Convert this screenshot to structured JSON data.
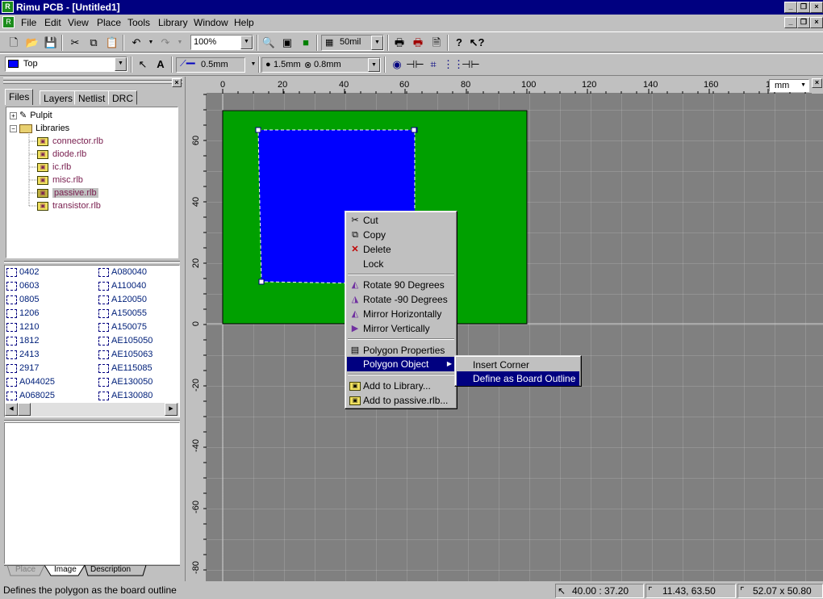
{
  "window": {
    "title": "Rimu PCB - [Untitled1]",
    "app_icon": "rimu-app-icon"
  },
  "menu": [
    "File",
    "Edit",
    "View",
    "Place",
    "Tools",
    "Library",
    "Window",
    "Help"
  ],
  "toolbar1": {
    "zoom": "100%",
    "grid": "50mil"
  },
  "toolbar2": {
    "layer": "Top",
    "track_width": "0.5mm",
    "via": "1.5mm",
    "hole": "0.8mm"
  },
  "panel": {
    "tabs": [
      "Files",
      "Layers",
      "Netlist",
      "DRC"
    ],
    "tree": {
      "pulpit": "Pulpit",
      "libraries": "Libraries",
      "libs": [
        "connector.rlb",
        "diode.rlb",
        "ic.rlb",
        "misc.rlb",
        "passive.rlb",
        "transistor.rlb"
      ]
    },
    "components_col1": [
      "0402",
      "0603",
      "0805",
      "1206",
      "1210",
      "1812",
      "2413",
      "2917",
      "A044025",
      "A068025"
    ],
    "components_col2": [
      "A080040",
      "A110040",
      "A120050",
      "A150055",
      "A150075",
      "AE105050",
      "AE105063",
      "AE115085",
      "AE130050",
      "AE130080"
    ],
    "bottom_tabs": [
      "Place",
      "Image",
      "Description"
    ]
  },
  "ruler": {
    "h_ticks": [
      "0",
      "20",
      "40",
      "60",
      "80",
      "100",
      "120",
      "140",
      "160",
      "1"
    ],
    "v_ticks": [
      "60",
      "40",
      "20",
      "0",
      "-20",
      "-40",
      "-60",
      "-80"
    ],
    "units": "mm"
  },
  "context_menu": {
    "items": [
      {
        "label": "Cut",
        "icon": "scissors-icon"
      },
      {
        "label": "Copy",
        "icon": "copy-icon"
      },
      {
        "label": "Delete",
        "icon": "delete-x-icon"
      },
      {
        "label": "Lock",
        "icon": ""
      },
      {
        "label": "Rotate 90 Degrees",
        "icon": "rotate-cw-icon"
      },
      {
        "label": "Rotate -90 Degrees",
        "icon": "rotate-ccw-icon"
      },
      {
        "label": "Mirror Horizontally",
        "icon": "mirror-h-icon"
      },
      {
        "label": "Mirror Vertically",
        "icon": "mirror-v-icon"
      },
      {
        "label": "Polygon Properties",
        "icon": "properties-icon"
      },
      {
        "label": "Polygon Object",
        "icon": ""
      },
      {
        "label": "Add to Library...",
        "icon": "library-icon"
      },
      {
        "label": "Add to passive.rlb...",
        "icon": "library-icon"
      }
    ],
    "submenu": [
      "Insert Corner",
      "Define as Board Outline"
    ]
  },
  "status": {
    "message": "Defines the polygon as the board outline",
    "cursor": "40.00 : 37.20",
    "position": "11.43, 63.50",
    "size": "52.07 x 50.80"
  },
  "colors": {
    "board": "#00a000",
    "polygon": "#0000ff",
    "canvas": "#808080",
    "highlight": "#000080"
  }
}
